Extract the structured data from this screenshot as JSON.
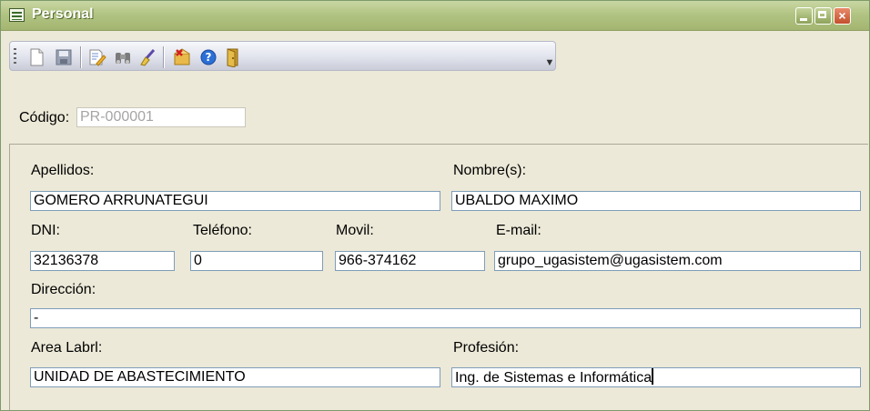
{
  "window": {
    "title": "Personal"
  },
  "toolbar": {
    "buttons": [
      "new-icon",
      "save-icon",
      "edit-icon",
      "search-icon",
      "clean-icon",
      "delete-icon",
      "help-icon",
      "exit-icon"
    ]
  },
  "form": {
    "codigo": {
      "label": "Código:",
      "value": "PR-000001"
    },
    "apellidos": {
      "label": "Apellidos:",
      "value": "GOMERO ARRUNATEGUI"
    },
    "nombres": {
      "label": "Nombre(s):",
      "value": "UBALDO MAXIMO"
    },
    "dni": {
      "label": "DNI:",
      "value": "32136378"
    },
    "telefono": {
      "label": "Teléfono:",
      "value": "0"
    },
    "movil": {
      "label": "Movil:",
      "value": "966-374162"
    },
    "email": {
      "label": "E-mail:",
      "value": "grupo_ugasistem@ugasistem.com"
    },
    "direccion": {
      "label": "Dirección:",
      "value": "-"
    },
    "area": {
      "label": "Area Labrl:",
      "value": "UNIDAD DE ABASTECIMIENTO"
    },
    "profesion": {
      "label": "Profesión:",
      "value": "Ing. de Sistemas e Informática"
    }
  },
  "colors": {
    "titlebar": "#b2c483",
    "window_bg": "#ece9d8",
    "field_border": "#7f9db9"
  }
}
